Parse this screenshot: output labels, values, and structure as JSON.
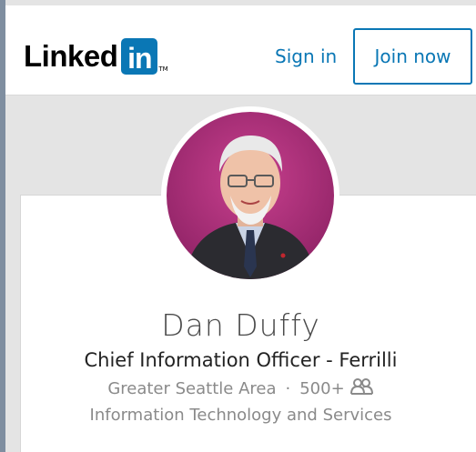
{
  "header": {
    "logo_word": "Linked",
    "logo_mark": "in",
    "logo_tm": "TM",
    "sign_in_label": "Sign in",
    "join_now_label": "Join now",
    "brand_color": "#0a77b5"
  },
  "profile": {
    "avatar": "profile-photo",
    "name": "Dan Duffy",
    "headline": "Chief Information Officer - Ferrilli",
    "location": "Greater Seattle Area",
    "separator": "·",
    "connections": "500+",
    "connections_icon": "connections-icon",
    "industry": "Information Technology and Services"
  }
}
